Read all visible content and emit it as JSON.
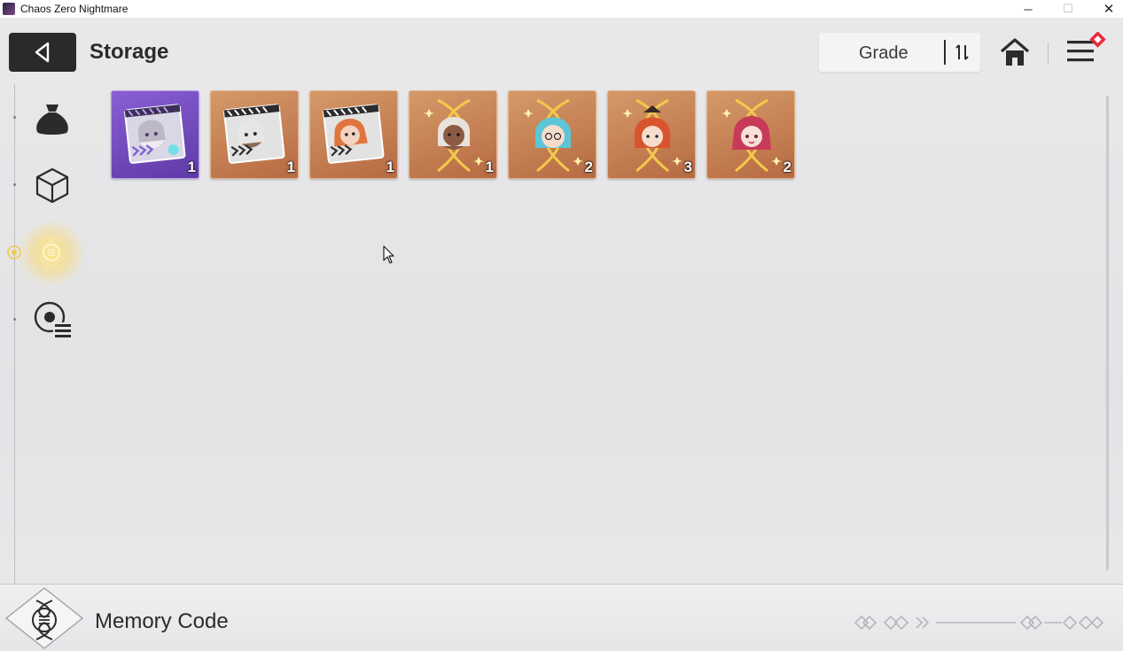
{
  "window": {
    "title": "Chaos Zero Nightmare",
    "minimize_glyph": "─",
    "maximize_glyph": "☐",
    "close_glyph": "✕"
  },
  "header": {
    "title": "Storage",
    "sort": {
      "label": "Grade"
    }
  },
  "sidebar": {
    "items": [
      {
        "icon": "pouch-icon",
        "active": false
      },
      {
        "icon": "cube-icon",
        "active": false
      },
      {
        "icon": "dna-helix-icon",
        "active": true
      },
      {
        "icon": "disc-list-icon",
        "active": false
      }
    ]
  },
  "items": [
    {
      "kind": "memory-card",
      "rarity": "purple",
      "count": "1"
    },
    {
      "kind": "memory-card",
      "rarity": "orange",
      "count": "1"
    },
    {
      "kind": "memory-card",
      "rarity": "orange",
      "count": "1"
    },
    {
      "kind": "helix-portrait",
      "rarity": "orange",
      "count": "1"
    },
    {
      "kind": "helix-portrait",
      "rarity": "orange",
      "count": "2"
    },
    {
      "kind": "helix-portrait",
      "rarity": "orange",
      "count": "3"
    },
    {
      "kind": "helix-portrait",
      "rarity": "orange",
      "count": "2"
    }
  ],
  "footer": {
    "title": "Memory Code"
  },
  "colors": {
    "accent_gold": "#f2c94c",
    "badge_red": "#e8283c",
    "rarity_purple": "#7a4fc9",
    "rarity_orange": "#c9814f"
  }
}
